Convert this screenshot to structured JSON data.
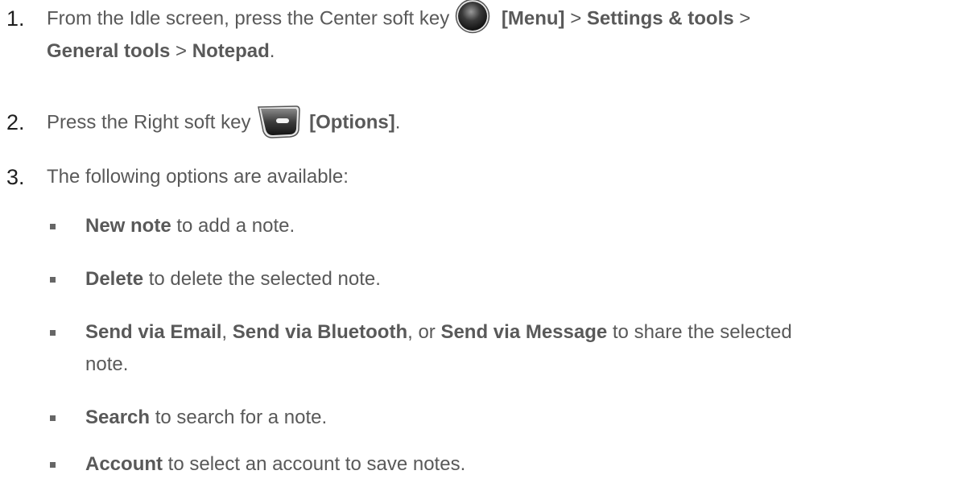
{
  "steps": [
    {
      "number": "1.",
      "line1": {
        "text_a": "From the Idle screen, press the Center soft key ",
        "bold_a": "[Menu]",
        "text_b": " > ",
        "bold_b": "Settings & tools",
        "text_c": " >"
      },
      "line2": {
        "bold_a": "General tools",
        "text_a": " > ",
        "bold_b": "Notepad",
        "text_b": "."
      },
      "icon": "center-soft-key-icon"
    },
    {
      "number": "2.",
      "text_a": "Press the Right soft key ",
      "bold_a": "[Options]",
      "text_b": ".",
      "icon": "right-soft-key-icon"
    },
    {
      "number": "3.",
      "text_a": "The following options are available:"
    }
  ],
  "options": [
    {
      "bold": "New note",
      "text": " to add a note."
    },
    {
      "bold": "Delete",
      "text": " to delete the selected note."
    },
    {
      "bold_a": "Send via Email",
      "text_a": ", ",
      "bold_b": "Send via Bluetooth",
      "text_b": ", or ",
      "bold_c": "Send via Message",
      "text_c": " to share the selected",
      "text_d": "note."
    },
    {
      "bold": "Search",
      "text": " to search for a note."
    },
    {
      "bold": "Account",
      "text": " to select an account to save notes."
    }
  ],
  "colors": {
    "body_text": "#595959",
    "number_text": "#1f1f1f",
    "bullet": "#666666"
  }
}
